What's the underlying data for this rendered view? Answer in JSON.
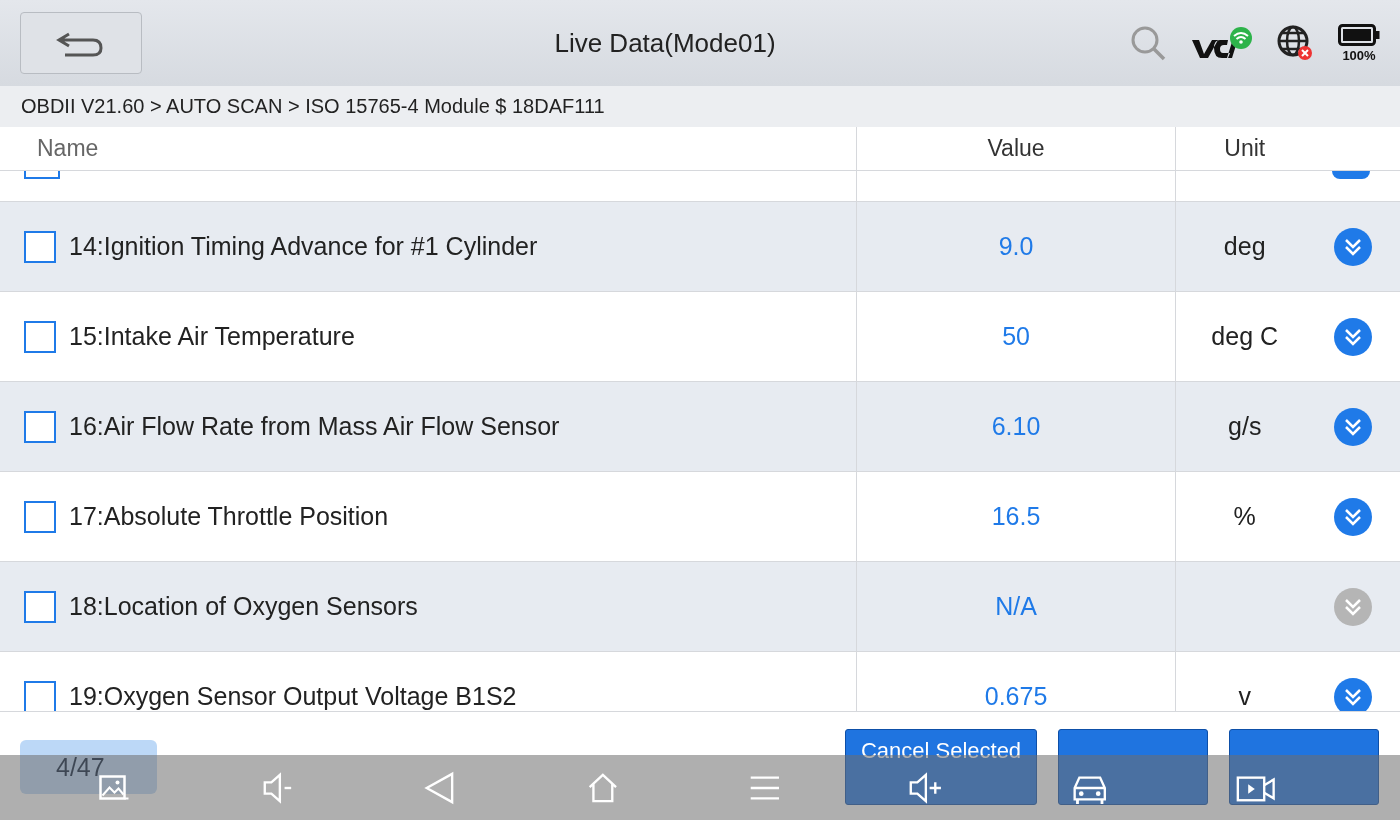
{
  "header": {
    "title": "Live Data(Mode01)",
    "battery": "100%"
  },
  "breadcrumb": "OBDII V21.60 > AUTO SCAN  > ISO 15765-4 Module $ 18DAF111",
  "table": {
    "columns": [
      "Name",
      "Value",
      "Unit"
    ],
    "rows": [
      {
        "name": "14:Ignition Timing Advance for #1 Cylinder",
        "value": "9.0",
        "unit": "deg",
        "checked": false,
        "enabled": true
      },
      {
        "name": "15:Intake Air Temperature",
        "value": "50",
        "unit": "deg C",
        "checked": false,
        "enabled": true
      },
      {
        "name": "16:Air Flow Rate from Mass Air Flow Sensor",
        "value": "6.10",
        "unit": "g/s",
        "checked": false,
        "enabled": true
      },
      {
        "name": "17:Absolute Throttle Position",
        "value": "16.5",
        "unit": "%",
        "checked": false,
        "enabled": true
      },
      {
        "name": "18:Location of Oxygen Sensors",
        "value": "N/A",
        "checked": false,
        "enabled": false
      },
      {
        "name": "19:Oxygen Sensor Output Voltage B1S2",
        "value": "0.675",
        "unit": "v",
        "checked": false,
        "enabled": true
      }
    ]
  },
  "footer": {
    "page": "4/47",
    "buttons": [
      "Cancel Selected"
    ]
  }
}
